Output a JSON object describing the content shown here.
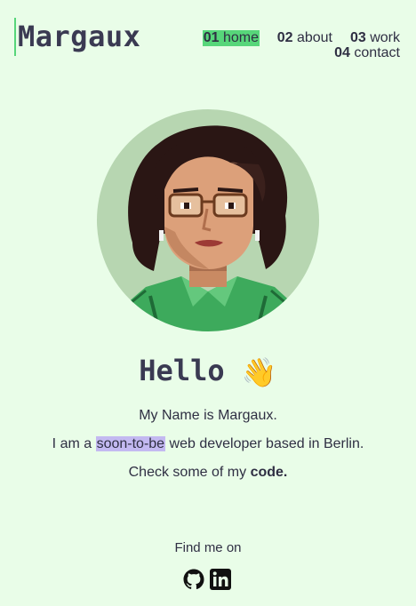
{
  "header": {
    "logo": "Margaux",
    "nav": [
      {
        "num": "01",
        "label": "home",
        "active": true
      },
      {
        "num": "02",
        "label": "about",
        "active": false
      },
      {
        "num": "03",
        "label": "work",
        "active": false
      },
      {
        "num": "04",
        "label": "contact",
        "active": false
      }
    ]
  },
  "hero": {
    "greeting": "Hello",
    "wave_emoji": "👋",
    "line1": "My Name is Margaux.",
    "line2_before": "I am a ",
    "line2_highlight": "soon-to-be",
    "line2_after": " web developer based in Berlin.",
    "line3_before": "Check some of my ",
    "line3_link": "code."
  },
  "footer": {
    "find_me": "Find me on",
    "socials": [
      {
        "icon": "github-icon"
      },
      {
        "icon": "linkedin-icon"
      }
    ]
  },
  "colors": {
    "background": "#e9fde8",
    "accent_green": "#57d67a",
    "highlight_purple": "#c3b9f1",
    "text": "#2f2f43"
  }
}
